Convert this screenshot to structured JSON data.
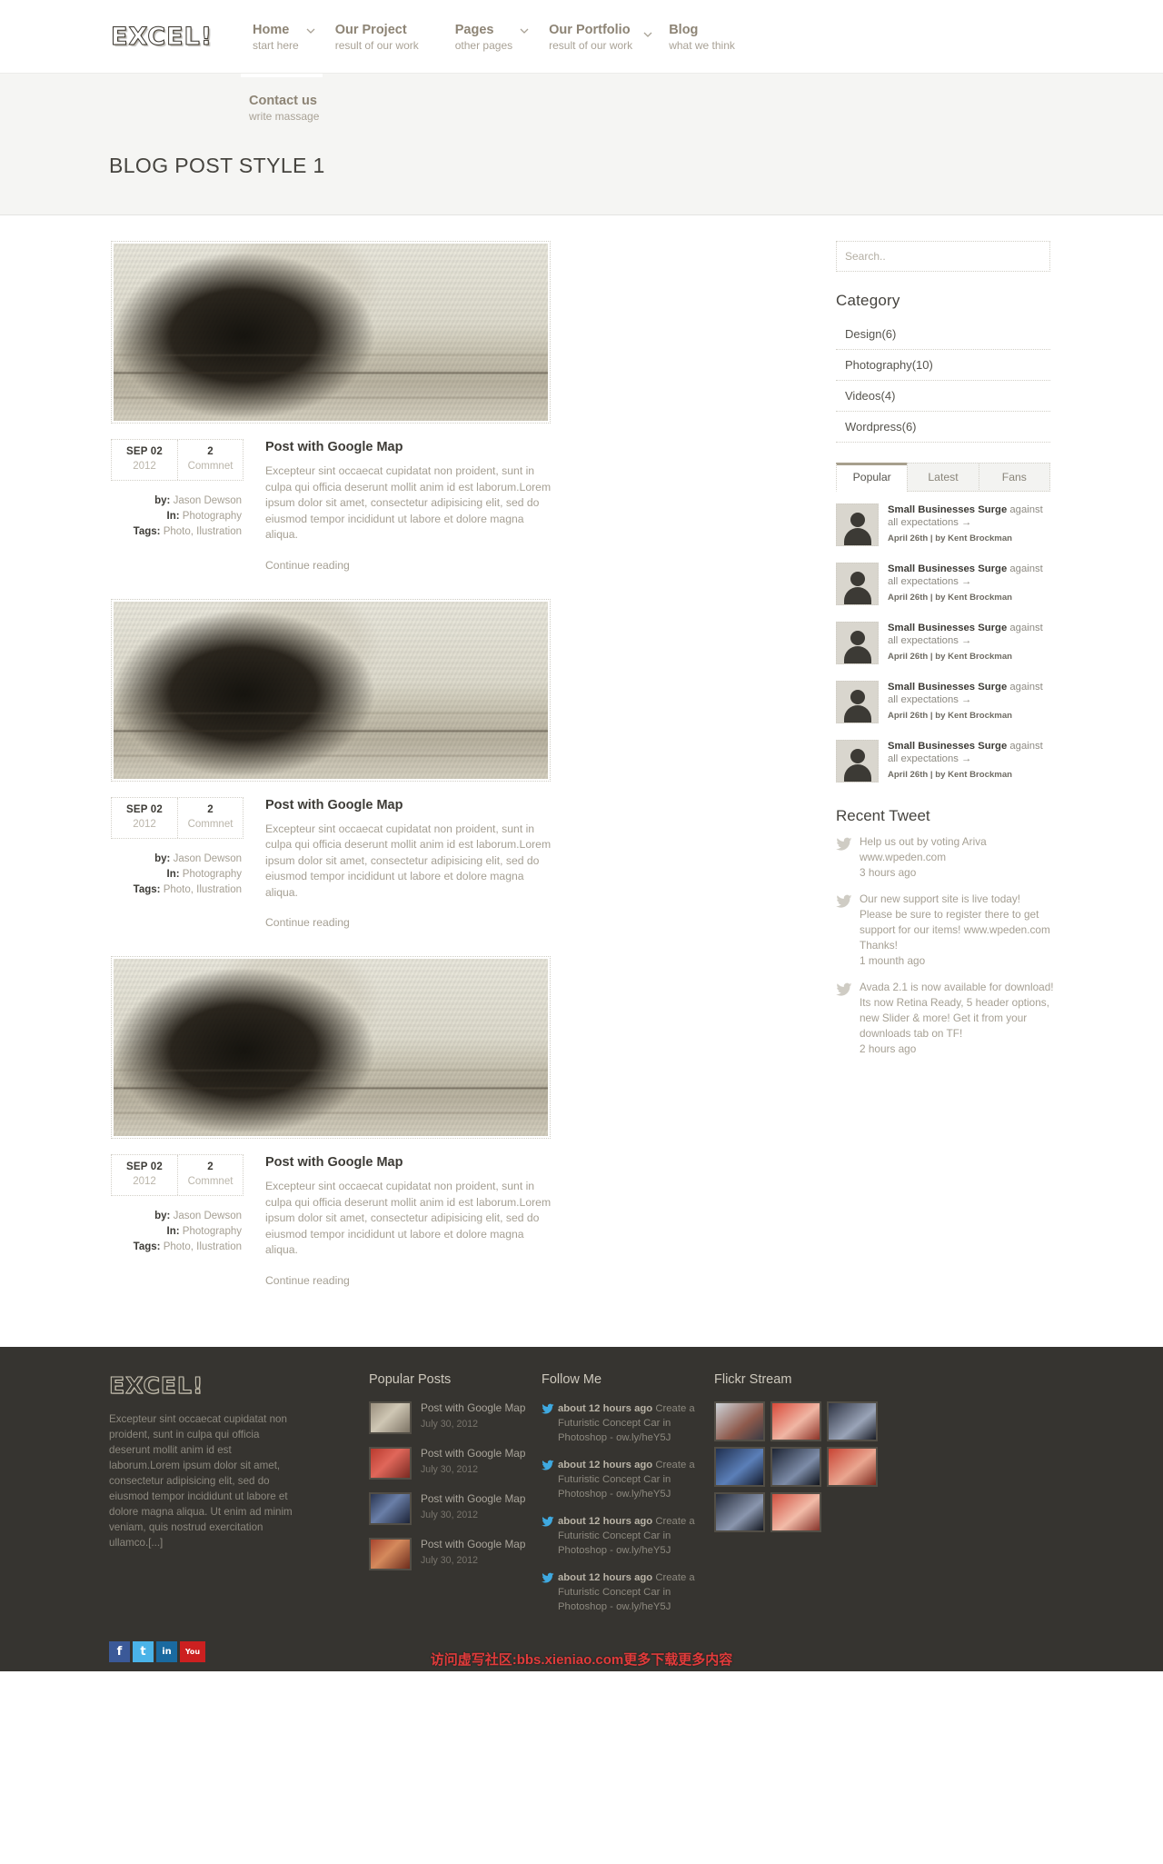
{
  "brand": {
    "logo": "EXCEL!",
    "accent": "#a79f8d"
  },
  "nav": {
    "items": [
      {
        "title": "Home",
        "sub": "start here",
        "caret": true
      },
      {
        "title": "Our Project",
        "sub": "result of our work",
        "caret": false
      },
      {
        "title": "Pages",
        "sub": "other pages",
        "caret": true
      },
      {
        "title": "Our Portfolio",
        "sub": "result of our work",
        "caret": true
      },
      {
        "title": "Blog",
        "sub": "what we think",
        "caret": false
      }
    ],
    "contact": {
      "title": "Contact us",
      "sub": "write massage"
    }
  },
  "page": {
    "title": "BLOG POST STYLE 1"
  },
  "posts": [
    {
      "date_month": "SEP 02",
      "date_year": "2012",
      "comment_count": "2",
      "comment_label": "Commnet",
      "by_label": "by:",
      "by_value": "Jason Dewson",
      "in_label": "In:",
      "in_value": "Photography",
      "tags_label": "Tags:",
      "tags_value": "Photo, Ilustration",
      "title": "Post with Google Map",
      "excerpt": "Excepteur sint occaecat cupidatat non proident, sunt in culpa qui officia deserunt mollit anim id est laborum.Lorem ipsum dolor sit amet, consectetur adipisicing elit, sed do eiusmod tempor incididunt ut labore et dolore magna aliqua.",
      "more": "Continue reading"
    },
    {
      "date_month": "SEP 02",
      "date_year": "2012",
      "comment_count": "2",
      "comment_label": "Commnet",
      "by_label": "by:",
      "by_value": "Jason Dewson",
      "in_label": "In:",
      "in_value": "Photography",
      "tags_label": "Tags:",
      "tags_value": "Photo, Ilustration",
      "title": "Post with Google Map",
      "excerpt": "Excepteur sint occaecat cupidatat non proident, sunt in culpa qui officia deserunt mollit anim id est laborum.Lorem ipsum dolor sit amet, consectetur adipisicing elit, sed do eiusmod tempor incididunt ut labore et dolore magna aliqua.",
      "more": "Continue reading"
    },
    {
      "date_month": "SEP 02",
      "date_year": "2012",
      "comment_count": "2",
      "comment_label": "Commnet",
      "by_label": "by:",
      "by_value": "Jason Dewson",
      "in_label": "In:",
      "in_value": "Photography",
      "tags_label": "Tags:",
      "tags_value": "Photo, Ilustration",
      "title": "Post with Google Map",
      "excerpt": "Excepteur sint occaecat cupidatat non proident, sunt in culpa qui officia deserunt mollit anim id est laborum.Lorem ipsum dolor sit amet, consectetur adipisicing elit, sed do eiusmod tempor incididunt ut labore et dolore magna aliqua.",
      "more": "Continue reading"
    }
  ],
  "sidebar": {
    "search_placeholder": "Search..",
    "category_heading": "Category",
    "categories": [
      {
        "label": "Design(6)"
      },
      {
        "label": "Photography(10)"
      },
      {
        "label": "Videos(4)"
      },
      {
        "label": "Wordpress(6)"
      }
    ],
    "tabs": [
      {
        "label": "Popular",
        "active": true
      },
      {
        "label": "Latest",
        "active": false
      },
      {
        "label": "Fans",
        "active": false
      }
    ],
    "tab_items": [
      {
        "bold": "Small Businesses Surge",
        "rest": "against all expectations →",
        "date": "April 26th | by Kent Brockman"
      },
      {
        "bold": "Small Businesses Surge",
        "rest": "against all expectations →",
        "date": "April 26th | by Kent Brockman"
      },
      {
        "bold": "Small Businesses Surge",
        "rest": "against all expectations →",
        "date": "April 26th | by Kent Brockman"
      },
      {
        "bold": "Small Businesses Surge",
        "rest": "against all expectations →",
        "date": "April 26th | by Kent Brockman"
      },
      {
        "bold": "Small Businesses Surge",
        "rest": "against all expectations →",
        "date": "April 26th | by Kent Brockman"
      }
    ],
    "tweet_heading": "Recent Tweet",
    "tweets": [
      {
        "text": "Help us out by voting Ariva www.wpeden.com",
        "time": "3 hours ago"
      },
      {
        "text": "Our new support site is live today! Please be sure to register there to get support for our items! www.wpeden.com Thanks!",
        "time": "1 mounth ago"
      },
      {
        "text": "Avada 2.1 is now available for download! Its now Retina Ready, 5 header options, new Slider & more! Get it from your downloads tab on TF!",
        "time": "2 hours ago"
      }
    ]
  },
  "footer": {
    "logo": "EXCEL!",
    "about": "Excepteur sint occaecat cupidatat non proident, sunt in culpa qui officia deserunt mollit anim id est laborum.Lorem ipsum dolor sit amet, consectetur adipisicing elit, sed do eiusmod tempor incididunt ut labore et dolore magna aliqua. Ut enim ad minim veniam, quis nostrud exercitation ullamco.[...]",
    "popular_heading": "Popular Posts",
    "popular": [
      {
        "title": "Post with Google Map",
        "date": "July 30, 2012"
      },
      {
        "title": "Post with Google Map",
        "date": "July 30, 2012"
      },
      {
        "title": "Post with Google Map",
        "date": "July 30, 2012"
      },
      {
        "title": "Post with Google Map",
        "date": "July 30, 2012"
      }
    ],
    "follow_heading": "Follow Me",
    "follow": [
      {
        "time": "about 12 hours ago",
        "text": "Create a Futuristic Concept Car in Photoshop - ",
        "link": "ow.ly/heY5J"
      },
      {
        "time": "about 12 hours ago",
        "text": "Create a Futuristic Concept Car in Photoshop - ",
        "link": "ow.ly/heY5J"
      },
      {
        "time": "about 12 hours ago",
        "text": "Create a Futuristic Concept Car in Photoshop - ",
        "link": "ow.ly/heY5J"
      },
      {
        "time": "about 12 hours ago",
        "text": "Create a Futuristic Concept Car in Photoshop - ",
        "link": "ow.ly/heY5J"
      }
    ],
    "flickr_heading": "Flickr Stream",
    "social": [
      {
        "name": "facebook",
        "glyph": "f",
        "color": "#3b5998"
      },
      {
        "name": "twitter",
        "glyph": "t",
        "color": "#4ab3e8"
      },
      {
        "name": "linkedin",
        "glyph": "in",
        "color": "#1a6aa0"
      },
      {
        "name": "youtube",
        "glyph": "You",
        "color": "#cc2020"
      }
    ]
  },
  "watermark": {
    "text": "访问虚写社区:bbs.xieniao.com更多下载更多内容"
  }
}
